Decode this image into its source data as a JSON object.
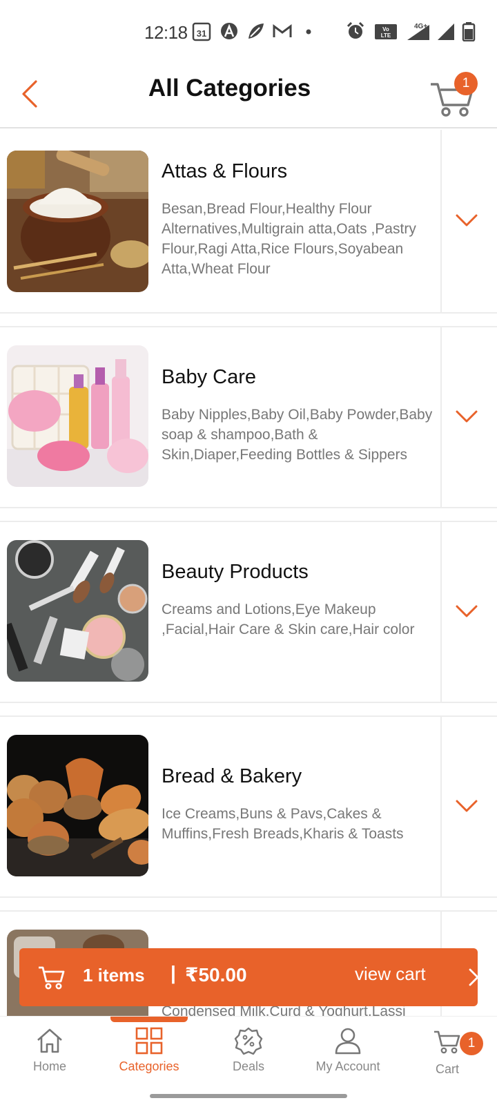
{
  "status_bar": {
    "time": "12:18",
    "calendar_day": "31",
    "network": "4G+"
  },
  "header": {
    "title": "All Categories",
    "cart_count": "1"
  },
  "categories": [
    {
      "name": "Attas & Flours",
      "subcategories": "Besan,Bread Flour,Healthy Flour Alternatives,Multigrain atta,Oats ,Pastry Flour,Ragi Atta,Rice Flours,Soyabean Atta,Wheat Flour",
      "image": "flour-bowl-photo"
    },
    {
      "name": "Baby Care",
      "subcategories": "Baby Nipples,Baby Oil,Baby Powder,Baby soap & shampoo,Bath & Skin,Diaper,Feeding Bottles & Sippers",
      "image": "baby-care-bottles-photo"
    },
    {
      "name": "Beauty Products",
      "subcategories": "Creams and Lotions,Eye Makeup ,Facial,Hair Care & Skin care,Hair color",
      "image": "makeup-brushes-photo"
    },
    {
      "name": "Bread & Bakery",
      "subcategories": "Ice Creams,Buns & Pavs,Cakes & Muffins,Fresh Breads,Kharis & Toasts",
      "image": "bakery-breads-photo"
    },
    {
      "name": "",
      "subcategories": "Condensed Milk,Curd & Yoghurt,Lassi",
      "image": "dairy-photo"
    }
  ],
  "cart_bar": {
    "count_label": "1 items",
    "separator": "|",
    "amount": "₹50.00",
    "action": "view cart"
  },
  "bottom_nav": {
    "items": [
      {
        "label": "Home",
        "icon": "home-icon"
      },
      {
        "label": "Categories",
        "icon": "grid-icon"
      },
      {
        "label": "Deals",
        "icon": "discount-badge-icon"
      },
      {
        "label": "My Account",
        "icon": "user-icon"
      },
      {
        "label": "Cart",
        "icon": "cart-icon"
      }
    ],
    "active": "Categories",
    "cart_badge": "1"
  },
  "colors": {
    "accent": "#e8622a",
    "text_primary": "#111111",
    "text_secondary": "#777777"
  }
}
